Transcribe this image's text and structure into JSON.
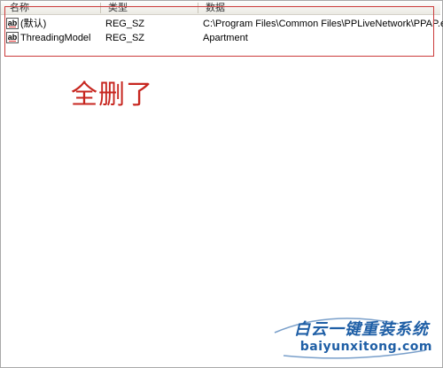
{
  "columns": {
    "name": "名称",
    "type": "类型",
    "data": "数据"
  },
  "rows": [
    {
      "icon": "string-value-icon",
      "icon_text": "ab",
      "name": "(默认)",
      "type": "REG_SZ",
      "data": "C:\\Program Files\\Common Files\\PPLiveNetwork\\PPAP.exe"
    },
    {
      "icon": "string-value-icon",
      "icon_text": "ab",
      "name": "ThreadingModel",
      "type": "REG_SZ",
      "data": "Apartment"
    }
  ],
  "annotation": "全删了",
  "watermark": {
    "brand": "白云一键重装系统",
    "url": "baiyunxitong.com"
  },
  "colors": {
    "annotation": "#c7261f",
    "highlight_border": "#cc3b3b",
    "watermark": "#1f5fa6"
  }
}
